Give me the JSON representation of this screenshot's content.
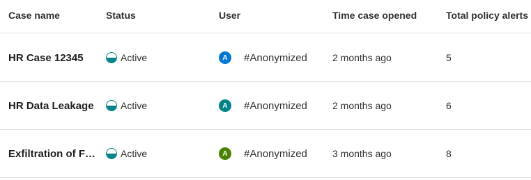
{
  "columns": {
    "case_name": "Case name",
    "status": "Status",
    "user": "User",
    "time_opened": "Time case opened",
    "total_alerts": "Total policy alerts"
  },
  "rows": [
    {
      "case_name": "HR Case 12345",
      "status": "Active",
      "avatar_initial": "A",
      "avatar_color": "#0078d4",
      "user": "#Anonymized",
      "time_opened": "2 months ago",
      "total_alerts": "5"
    },
    {
      "case_name": "HR Data Leakage",
      "status": "Active",
      "avatar_initial": "A",
      "avatar_color": "#038387",
      "user": "#Anonymized",
      "time_opened": "2 months ago",
      "total_alerts": "6"
    },
    {
      "case_name": "Exfiltration of Files",
      "status": "Active",
      "avatar_initial": "A",
      "avatar_color": "#498205",
      "user": "#Anonymized",
      "time_opened": "3 months ago",
      "total_alerts": "8"
    }
  ],
  "status_icon": "half-filled-circle-icon",
  "status_color": "#038387"
}
